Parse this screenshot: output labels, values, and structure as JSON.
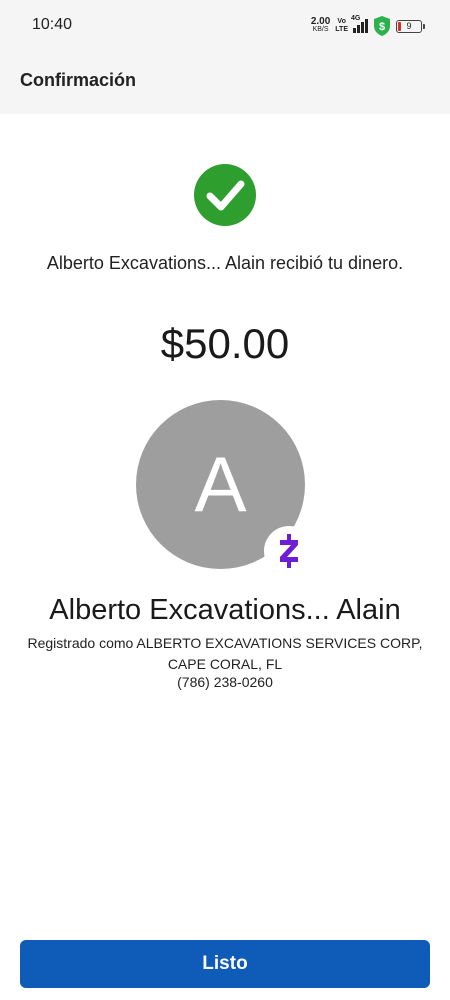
{
  "status_bar": {
    "time": "10:40",
    "net_speed_value": "2.00",
    "net_speed_unit": "KB/S",
    "volte_top": "Vo",
    "volte_bottom": "LTE",
    "signal_label": "4G",
    "battery_level": "9",
    "icons": [
      "speed-indicator",
      "volte-icon",
      "signal-icon",
      "shield-dollar-icon",
      "battery-icon"
    ]
  },
  "header": {
    "title": "Confirmación"
  },
  "confirmation": {
    "icon": "checkmark-circle-icon",
    "message": "Alberto Excavations... Alain recibió tu dinero.",
    "amount": "$50.00"
  },
  "recipient": {
    "avatar_initial": "A",
    "badge_icon": "zelle-icon",
    "name": "Alberto Excavations... Alain",
    "registered_as": "Registrado como ALBERTO EXCAVATIONS SERVICES CORP, CAPE CORAL, FL",
    "phone": "(786) 238-0260"
  },
  "actions": {
    "done_label": "Listo"
  },
  "colors": {
    "success_green": "#2e9e2e",
    "primary_blue": "#0e5bb8",
    "avatar_gray": "#9e9e9e",
    "zelle_purple": "#6d1ed4",
    "shield_green": "#2bb24c"
  }
}
